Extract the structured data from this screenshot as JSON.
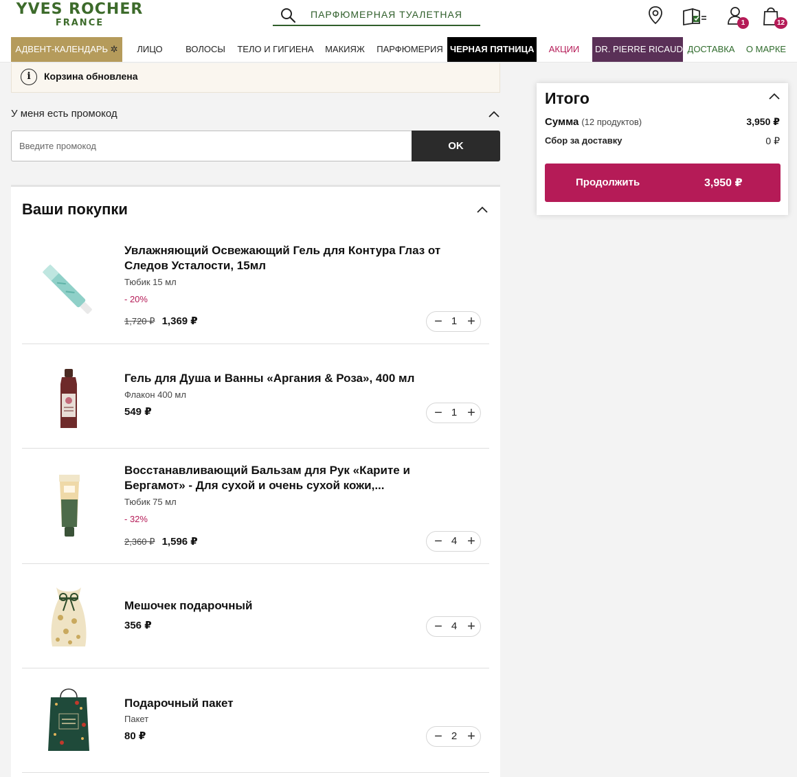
{
  "brand": {
    "line1": "YVES ROCHER",
    "line2": "FRANCE"
  },
  "search": {
    "text": "ПАРФЮМЕРНАЯ ТУАЛЕТНАЯ"
  },
  "header_icons": {
    "account_badge": "1",
    "cart_badge": "12"
  },
  "nav": [
    "АДВЕНТ-КАЛЕНДАРЬ",
    "ЛИЦО",
    "ВОЛОСЫ",
    "ТЕЛО И ГИГИЕНА",
    "МАКИЯЖ",
    "ПАРФЮМЕРИЯ",
    "ЧЕРНАЯ ПЯТНИЦА",
    "АКЦИИ",
    "DR. PIERRE RICAUD",
    "ДОСТАВКА",
    "О МАРКЕ"
  ],
  "notice": {
    "icon": "i",
    "text": "Корзина обновлена"
  },
  "promo": {
    "label": "У меня есть промокод",
    "placeholder": "Введите промокод",
    "ok": "OK"
  },
  "cart": {
    "title": "Ваши покупки",
    "items": [
      {
        "name": "Увлажняющий Освежающий Гель для Контура Глаз от Следов Усталости, 15мл",
        "sub": "Тюбик 15 мл",
        "discount": "- 20%",
        "old_price": "1,720 ₽",
        "price": "1,369 ₽",
        "qty": "1"
      },
      {
        "name": "Гель для Душа и Ванны «Аргания & Роза», 400 мл",
        "sub": "Флакон 400 мл",
        "price": "549 ₽",
        "qty": "1"
      },
      {
        "name": "Восстанавливающий Бальзам для Рук «Карите и Бергамот» - Для сухой и очень сухой кожи,...",
        "sub": "Тюбик 75 мл",
        "discount": "- 32%",
        "old_price": "2,360 ₽",
        "price": "1,596 ₽",
        "qty": "4"
      },
      {
        "name": "Мешочек подарочный",
        "price": "356 ₽",
        "qty": "4"
      },
      {
        "name": "Подарочный пакет",
        "sub": "Пакет",
        "price": "80 ₽",
        "qty": "2"
      }
    ]
  },
  "summary": {
    "title": "Итого",
    "sum_label": "Сумма",
    "sum_count": "(12 продуктов)",
    "sum_value": "3,950 ₽",
    "delivery_label": "Сбор за доставку",
    "delivery_value": "0 ₽",
    "continue_label": "Продолжить",
    "continue_amount": "3,950 ₽"
  },
  "colors": {
    "brand_green": "#3d6b2b",
    "accent": "#b51b57",
    "dark": "#2b2b2b",
    "advent": "#b59b5b",
    "pierre": "#5a3057"
  }
}
